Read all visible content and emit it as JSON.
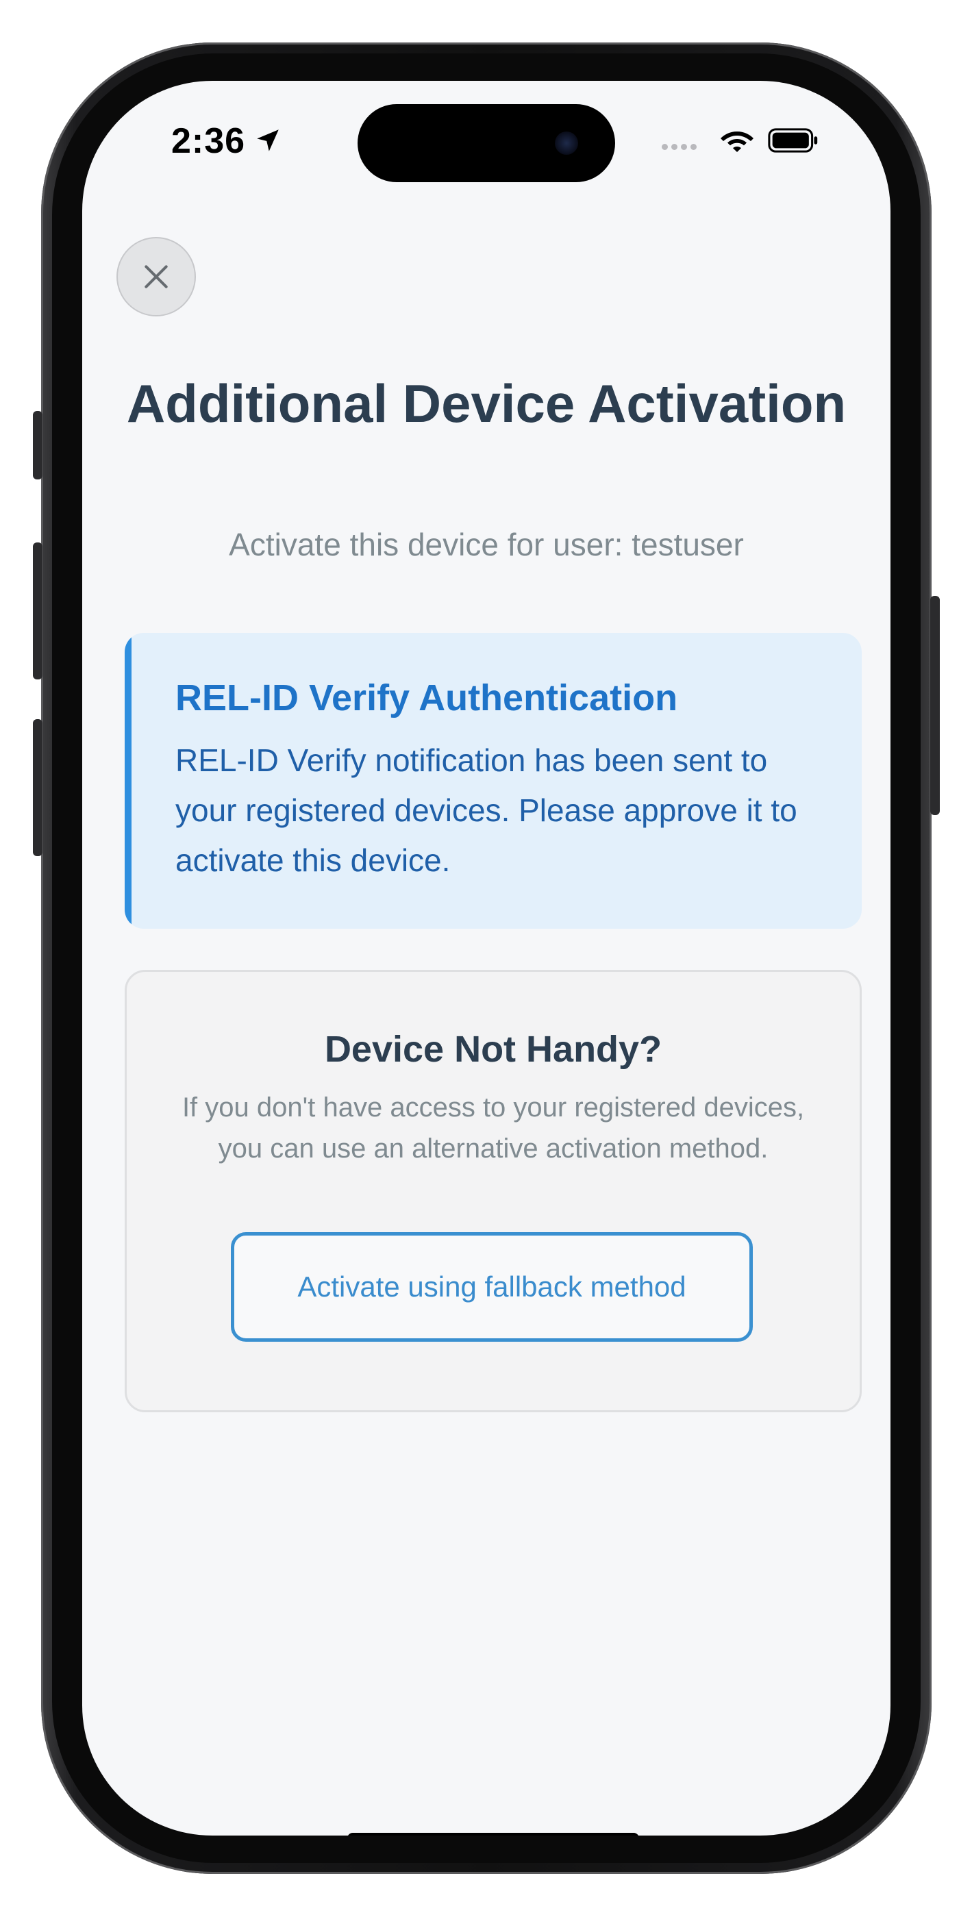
{
  "status_bar": {
    "time": "2:36",
    "icons": [
      "location-arrow-icon",
      "cellular-dots-icon",
      "wifi-icon",
      "battery-icon"
    ]
  },
  "header": {
    "close_icon": "close-icon",
    "title": "Additional Device Activation",
    "subtitle": "Activate this device for user: testuser"
  },
  "verify_card": {
    "title": "REL-ID Verify Authentication",
    "body": "REL-ID Verify notification has been sent to your registered devices. Please approve it to activate this device.",
    "accent_color": "#2f8fdf"
  },
  "fallback_card": {
    "title": "Device Not Handy?",
    "description": "If you don't have access to your registered devices, you can use an alternative activation method.",
    "button_label": "Activate using fallback method"
  },
  "colors": {
    "heading": "#2c3e50",
    "muted": "#7f8a90",
    "link_blue": "#3a8ccd",
    "info_bg": "#e3f0fb"
  }
}
